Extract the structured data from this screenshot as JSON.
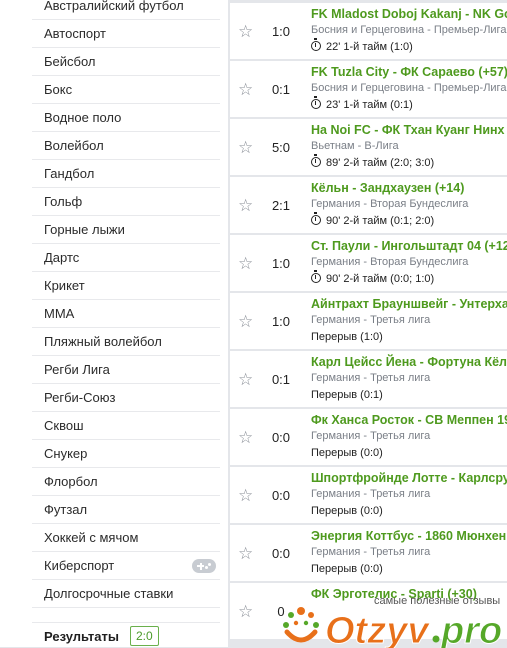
{
  "sidebar": {
    "items": [
      {
        "label": "Австралийский футбол"
      },
      {
        "label": "Автоспорт"
      },
      {
        "label": "Бейсбол"
      },
      {
        "label": "Бокс"
      },
      {
        "label": "Водное поло"
      },
      {
        "label": "Волейбол"
      },
      {
        "label": "Гандбол"
      },
      {
        "label": "Гольф"
      },
      {
        "label": "Горные лыжи"
      },
      {
        "label": "Дартс"
      },
      {
        "label": "Крикет"
      },
      {
        "label": "MMA"
      },
      {
        "label": "Пляжный волейбол"
      },
      {
        "label": "Регби Лига"
      },
      {
        "label": "Регби-Союз"
      },
      {
        "label": "Сквош"
      },
      {
        "label": "Снукер"
      },
      {
        "label": "Флорбол"
      },
      {
        "label": "Футзал"
      },
      {
        "label": "Хоккей с мячом"
      },
      {
        "label": "Киберспорт",
        "icon": "gamepad-icon"
      },
      {
        "label": "Долгосрочные ставки"
      }
    ],
    "results": {
      "label": "Результаты",
      "badge": "2:0"
    }
  },
  "matches": [
    {
      "score": "1:0",
      "teams": "FK Mladost Doboj Kakanj - NK Gosk",
      "league": "Босния и Герцеговина - Премьер-Лига",
      "status": "22' 1-й тайм (1:0)",
      "live": true
    },
    {
      "score": "0:1",
      "teams": "FK Tuzla City - ФК Сараево (+57)",
      "league": "Босния и Герцеговина - Премьер-Лига",
      "status": "23' 1-й тайм (0:1)",
      "live": true
    },
    {
      "score": "5:0",
      "teams": "Ha Noi FC - ФК Тхан Куанг Нинх (",
      "league": "Вьетнам - В-Лига",
      "status": "89' 2-й тайм (2:0; 3:0)",
      "live": true
    },
    {
      "score": "2:1",
      "teams": "Кёльн - Зандхаузен (+14)",
      "league": "Германия - Вторая Бундеслига",
      "status": "90' 2-й тайм (0:1; 2:0)",
      "live": true
    },
    {
      "score": "1:0",
      "teams": "Ст. Паули - Ингольштадт 04 (+12",
      "league": "Германия - Вторая Бундеслига",
      "status": "90' 2-й тайм (0:0; 1:0)",
      "live": true
    },
    {
      "score": "1:0",
      "teams": "Айнтрахт Брауншвейг - Унтерхаз",
      "league": "Германия - Третья лига",
      "status": "Перерыв (1:0)",
      "live": false
    },
    {
      "score": "0:1",
      "teams": "Карл Цейсс Йена - Фортуна Кёльн",
      "league": "Германия - Третья лига",
      "status": "Перерыв (0:1)",
      "live": false
    },
    {
      "score": "0:0",
      "teams": "Фк Ханса Росток - СВ Меппен 19",
      "league": "Германия - Третья лига",
      "status": "Перерыв (0:0)",
      "live": false
    },
    {
      "score": "0:0",
      "teams": "Шпортфройнде Лотте - Карлсру",
      "league": "Германия - Третья лига",
      "status": "Перерыв (0:0)",
      "live": false
    },
    {
      "score": "0:0",
      "teams": "Энергия Коттбус - 1860 Мюнхен",
      "league": "Германия - Третья лига",
      "status": "Перерыв (0:0)",
      "live": false
    },
    {
      "score": "0",
      "teams": "ФК Эрготелис - Sparti (+30)",
      "league": "",
      "status": "",
      "live": false
    }
  ],
  "watermark": {
    "slogan": "самые полезные отзывы",
    "logo_text": "Otzyv.pro"
  },
  "colors": {
    "accent": "#4e9a1e",
    "page_bg": "#e4e6ea",
    "logo_orange": "#e8701a",
    "logo_green": "#56a829"
  }
}
